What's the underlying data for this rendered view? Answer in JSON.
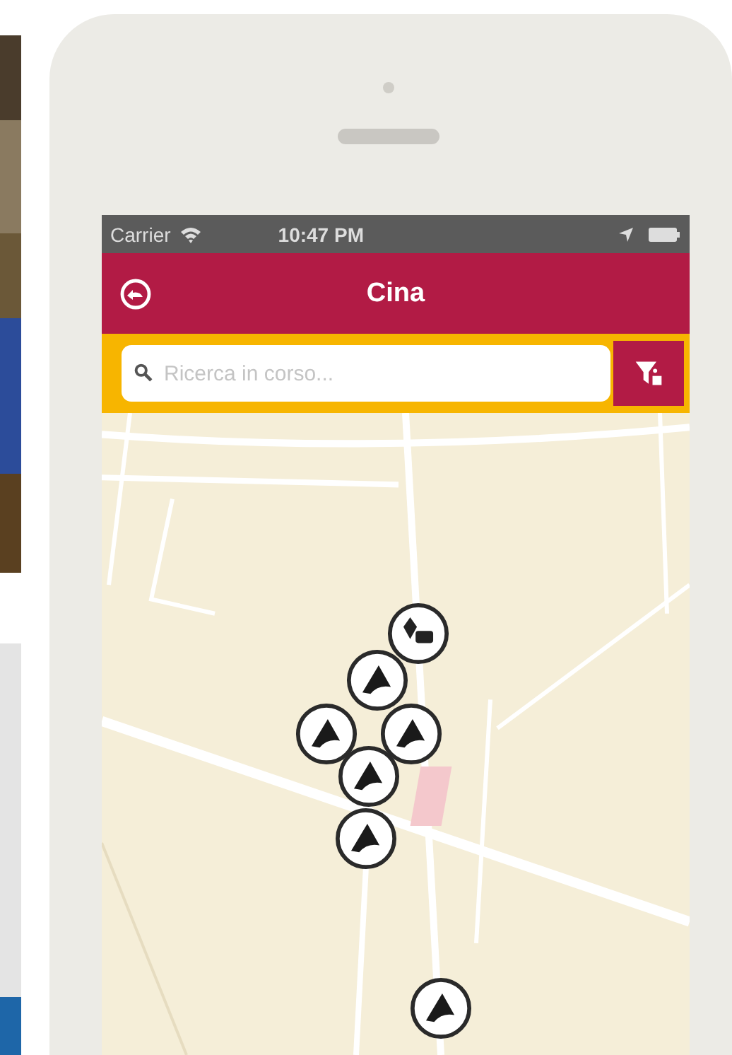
{
  "status_bar": {
    "carrier": "Carrier",
    "time": "10:47 PM"
  },
  "nav_bar": {
    "title": "Cina"
  },
  "search": {
    "placeholder": "Ricerca in corso..."
  },
  "map": {
    "kind": "picture",
    "markers": [
      {
        "kind": "pair"
      },
      {
        "kind": "single"
      },
      {
        "kind": "single"
      },
      {
        "kind": "single"
      },
      {
        "kind": "single"
      },
      {
        "kind": "single"
      },
      {
        "kind": "single"
      }
    ]
  }
}
